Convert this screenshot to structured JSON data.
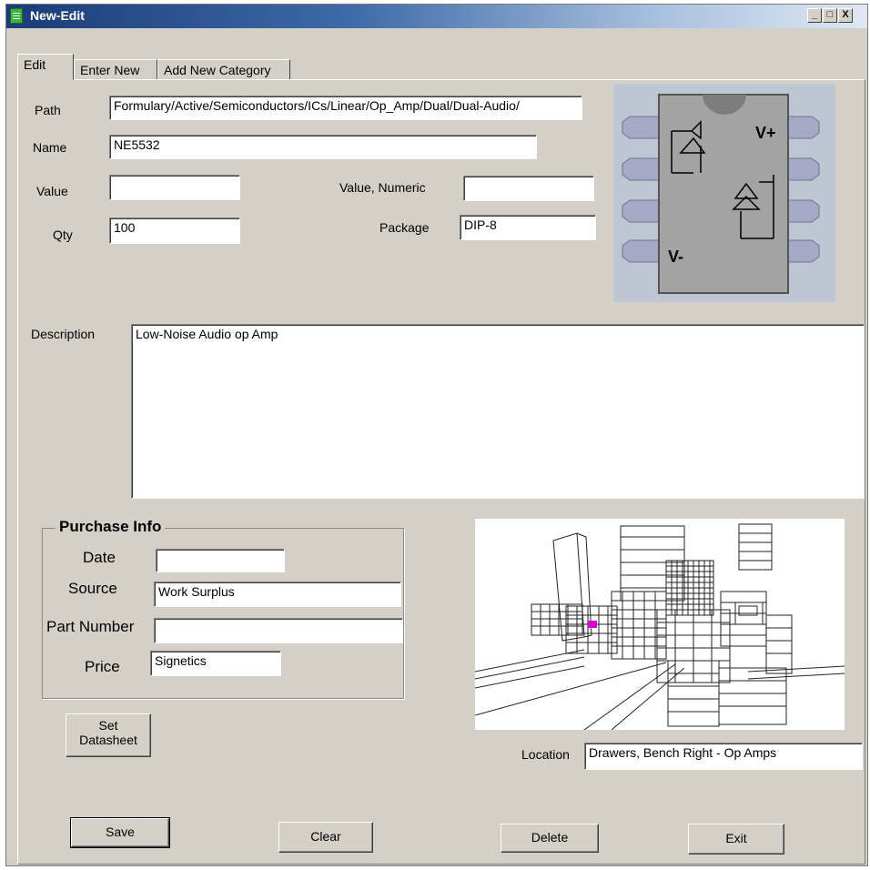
{
  "window": {
    "title": "New-Edit",
    "controls": [
      "_",
      "□",
      "X"
    ]
  },
  "tabs": [
    {
      "label": "Edit",
      "active": true
    },
    {
      "label": "Enter New",
      "active": false
    },
    {
      "label": "Add New Category",
      "active": false
    }
  ],
  "fields": {
    "path": {
      "label": "Path",
      "value": "Formulary/Active/Semiconductors/ICs/Linear/Op_Amp/Dual/Dual-Audio/"
    },
    "name": {
      "label": "Name",
      "value": "NE5532"
    },
    "value": {
      "label": "Value",
      "value": ""
    },
    "value_numeric": {
      "label": "Value, Numeric",
      "value": ""
    },
    "qty": {
      "label": "Qty",
      "value": "100"
    },
    "package": {
      "label": "Package",
      "value": "DIP-8"
    },
    "description": {
      "label": "Description",
      "value": "Low-Noise Audio op Amp"
    }
  },
  "chip_image": {
    "vplus": "V+",
    "vminus": "V-"
  },
  "purchase_info": {
    "title": "Purchase Info",
    "date": {
      "label": "Date",
      "value": ""
    },
    "source": {
      "label": "Source",
      "value": "Work Surplus"
    },
    "part_number": {
      "label": "Part Number",
      "value": ""
    },
    "price": {
      "label": "Price",
      "value": "Signetics"
    }
  },
  "datasheet_button": {
    "line1": "Set",
    "line2": "Datasheet"
  },
  "location": {
    "label": "Location",
    "value": "Drawers, Bench Right - Op Amps"
  },
  "buttons": {
    "save": "Save",
    "clear": "Clear",
    "delete": "Delete",
    "exit": "Exit"
  },
  "colors": {
    "title_start": "#1a3c78",
    "window_bg": "#d4d0c8",
    "highlight_drawer": "#d400d4",
    "chip_bg": "#bdc6d2"
  }
}
